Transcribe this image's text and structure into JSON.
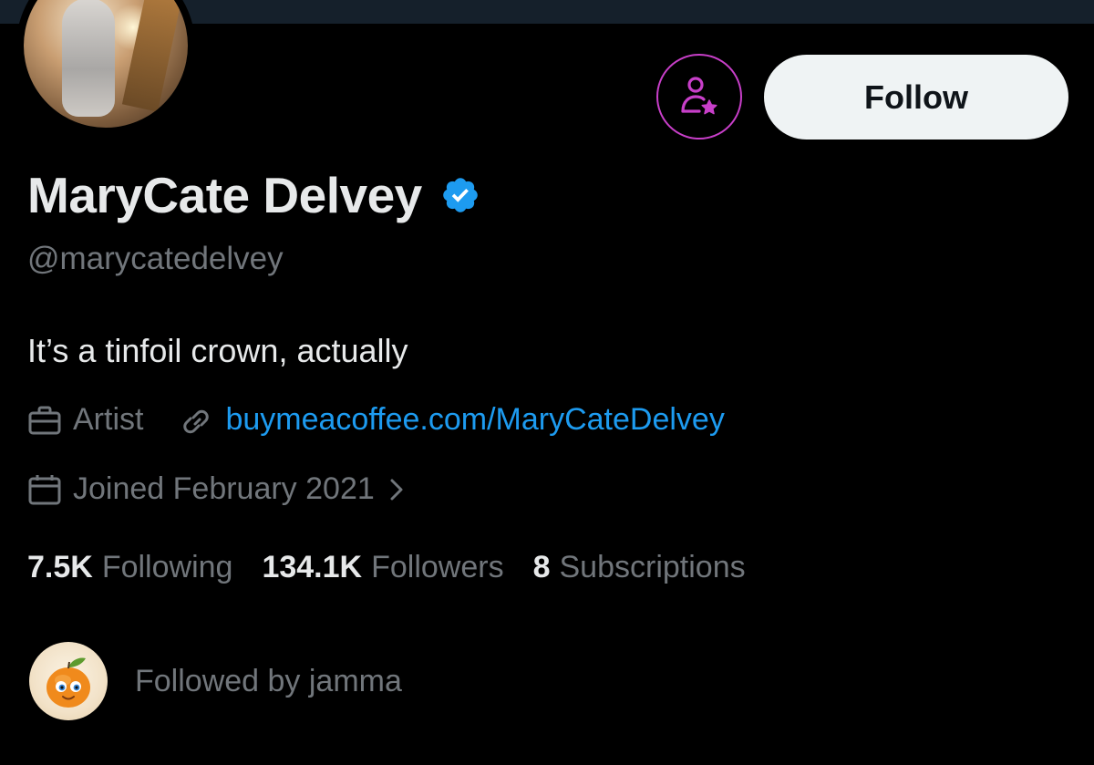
{
  "profile": {
    "display_name": "MaryCate Delvey",
    "handle": "@marycatedelvey",
    "bio": "It’s a tinfoil crown, actually",
    "category": "Artist",
    "website": "buymeacoffee.com/MaryCateDelvey",
    "joined": "Joined February 2021"
  },
  "actions": {
    "follow_label": "Follow",
    "subscribe_icon": "person-star-icon"
  },
  "stats": [
    {
      "value": "7.5K",
      "label": "Following"
    },
    {
      "value": "134.1K",
      "label": "Followers"
    },
    {
      "value": "8",
      "label": "Subscriptions"
    }
  ],
  "followed_by": {
    "text": "Followed by jamma"
  },
  "colors": {
    "background": "#000000",
    "banner": "#15202b",
    "primary_text": "#e7e9ea",
    "secondary_text": "#71767b",
    "link": "#1d9bf0",
    "verified": "#1d9bf0",
    "subscribe_accent": "#c83fc9",
    "follow_button_bg": "#eff3f4"
  }
}
